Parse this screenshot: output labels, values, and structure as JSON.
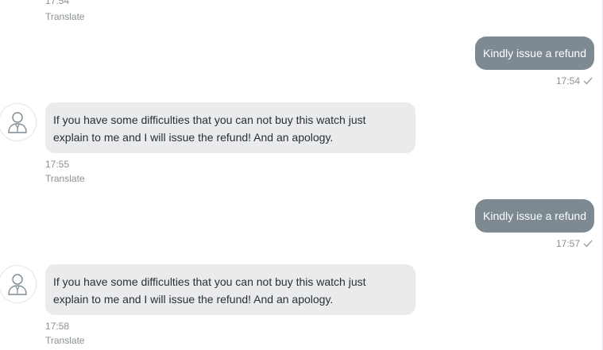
{
  "messages": [
    {
      "type": "incoming-meta",
      "time": "17:54",
      "translate": "Translate"
    },
    {
      "type": "outgoing",
      "text": "Kindly issue a refund",
      "time": "17:54",
      "status_icon": "check-icon"
    },
    {
      "type": "incoming",
      "avatar_icon": "user-avatar-icon",
      "lines": [
        "If you have some difficulties that you can not buy this watch just",
        "explain to me and I will issue the refund! And an apology."
      ],
      "time": "17:55",
      "translate": "Translate"
    },
    {
      "type": "outgoing",
      "text": "Kindly issue a refund",
      "time": "17:57",
      "status_icon": "check-icon"
    },
    {
      "type": "incoming",
      "avatar_icon": "user-avatar-icon",
      "lines": [
        "If you have some difficulties that you can not buy this watch just",
        "explain to me and I will issue the refund! And an apology."
      ],
      "time": "17:58",
      "translate": "Translate"
    }
  ],
  "colors": {
    "outgoing_bubble": "#7d8a92",
    "incoming_bubble": "#e9ebed",
    "meta_text": "#8a9196"
  }
}
